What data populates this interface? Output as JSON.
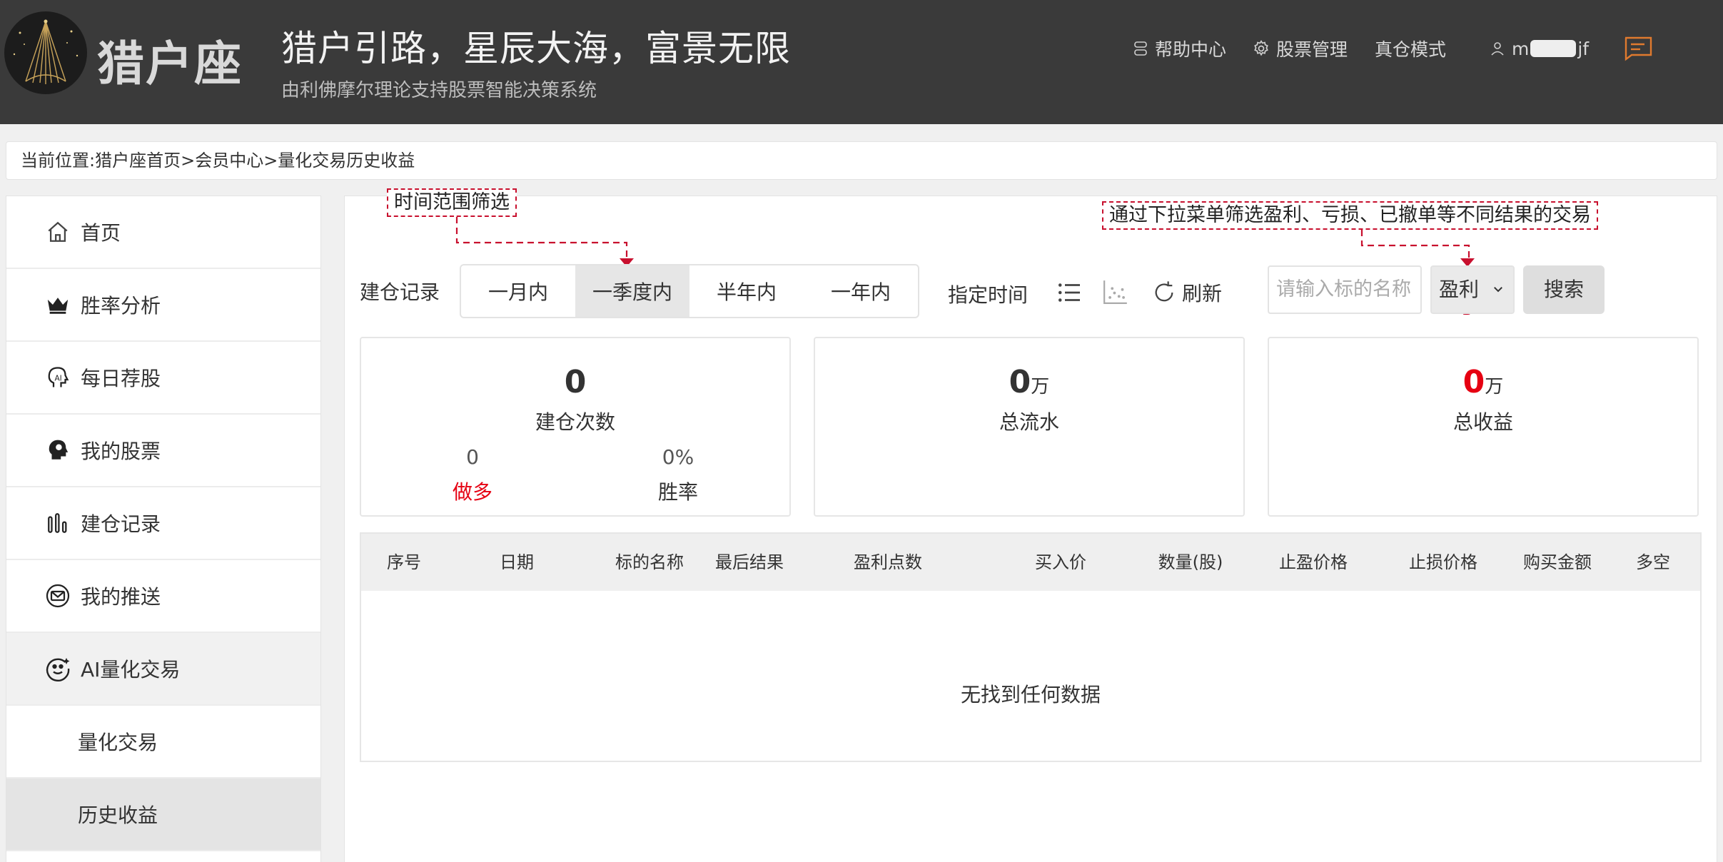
{
  "header": {
    "logo_text": "猎户座",
    "slogan": "猎户引路，星辰大海，富景无限",
    "subslogan": "由利佛摩尔理论支持股票智能决策系统",
    "nav": {
      "help": "帮助中心",
      "stock_mgmt": "股票管理",
      "real_mode": "真仓模式",
      "user_prefix": "m",
      "user_suffix": "jf"
    }
  },
  "breadcrumb": "当前位置:猎户座首页>会员中心>量化交易历史收益",
  "sidebar": {
    "items": [
      {
        "label": "首页",
        "icon": "home-icon"
      },
      {
        "label": "胜率分析",
        "icon": "crown-icon"
      },
      {
        "label": "每日荐股",
        "icon": "ai-head-icon"
      },
      {
        "label": "我的股票",
        "icon": "brain-icon"
      },
      {
        "label": "建仓记录",
        "icon": "bar-chart-icon"
      },
      {
        "label": "我的推送",
        "icon": "mail-icon"
      },
      {
        "label": "AI量化交易",
        "icon": "robot-face-icon"
      },
      {
        "label": "量化交易"
      },
      {
        "label": "历史收益"
      }
    ]
  },
  "annotations": {
    "time_filter": "时间范围筛选",
    "result_filter": "通过下拉菜单筛选盈利、亏损、已撤单等不同结果的交易"
  },
  "filters": {
    "label": "建仓记录",
    "ranges": [
      "一月内",
      "一季度内",
      "半年内",
      "一年内"
    ],
    "active_range": 1,
    "specify_time": "指定时间",
    "refresh": "刷新",
    "search_placeholder": "请输入标的名称",
    "result_select": "盈利",
    "search_button": "搜索"
  },
  "stats": {
    "count_value": "0",
    "count_label": "建仓次数",
    "long_value": "0",
    "long_label": "做多",
    "winrate_value": "0%",
    "winrate_label": "胜率",
    "flow_value": "0",
    "flow_unit": "万",
    "flow_label": "总流水",
    "profit_value": "0",
    "profit_unit": "万",
    "profit_label": "总收益"
  },
  "table": {
    "columns": [
      "序号",
      "日期",
      "标的名称",
      "最后结果",
      "盈利点数",
      "买入价",
      "数量(股)",
      "止盈价格",
      "止损价格",
      "购买金额",
      "多空"
    ],
    "empty_text": "无找到任何数据"
  },
  "colors": {
    "header_bg": "#3a3a3a",
    "accent_red": "#e60012",
    "annotation_red": "#c8102e"
  }
}
